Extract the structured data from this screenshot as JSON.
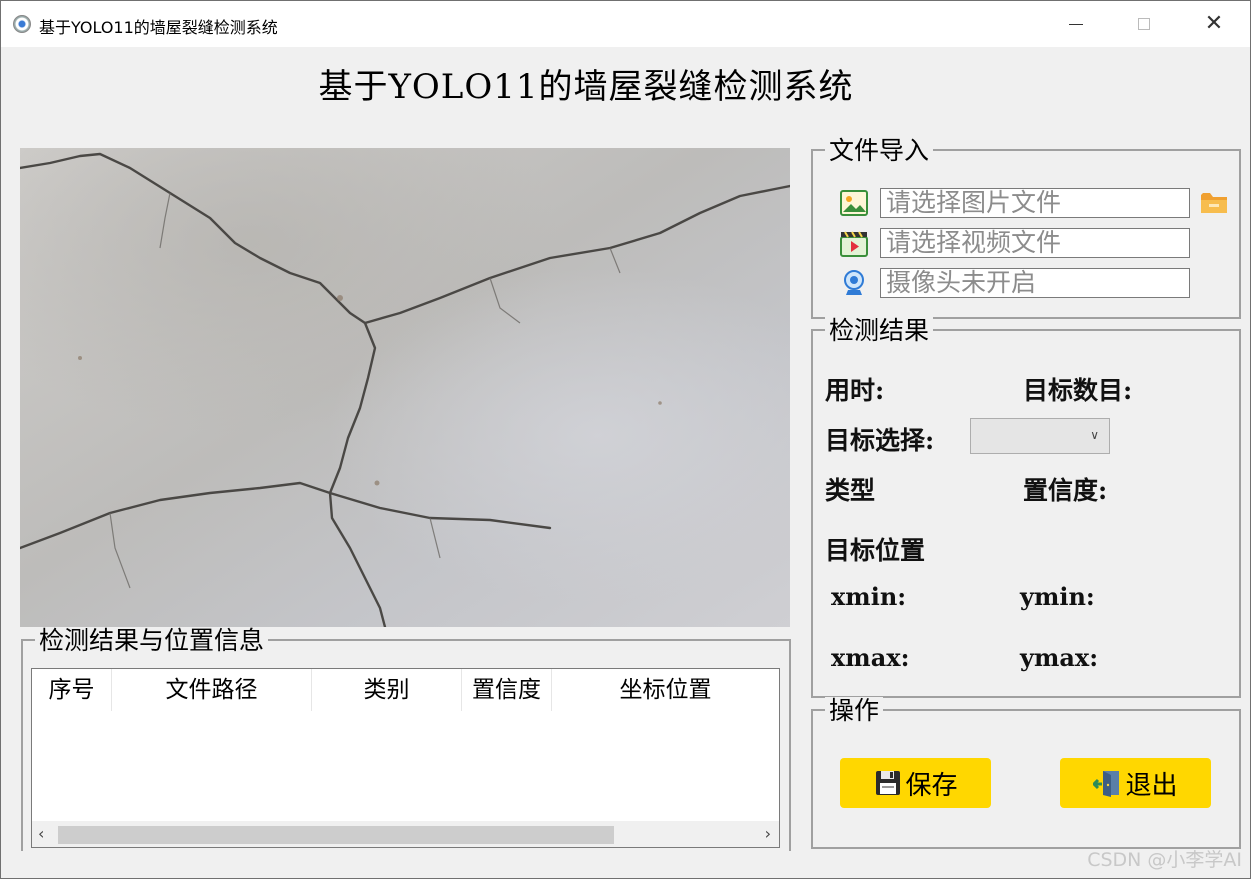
{
  "window": {
    "title": "基于YOLO11的墙屋裂缝检测系统",
    "controls": {
      "minimize": "—",
      "maximize": "□",
      "close": "✕"
    }
  },
  "header": {
    "title": "基于YOLO11的墙屋裂缝检测系统"
  },
  "image_view": {
    "content": "wall-crack-photo"
  },
  "file_import": {
    "group_title": "文件导入",
    "image_placeholder": "请选择图片文件",
    "video_placeholder": "请选择视频文件",
    "camera_placeholder": "摄像头未开启",
    "icons": [
      "image-icon",
      "video-icon",
      "webcam-icon",
      "folder-icon"
    ]
  },
  "detection": {
    "group_title": "检测结果",
    "time_label": "用时:",
    "count_label": "目标数目:",
    "select_label": "目标选择:",
    "select_value": "",
    "type_label": "类型",
    "confidence_label": "置信度:",
    "position_label": "目标位置",
    "xmin_label": "xmin:",
    "ymin_label": "ymin:",
    "xmax_label": "xmax:",
    "ymax_label": "ymax:"
  },
  "operations": {
    "group_title": "操作",
    "save_label": "保存",
    "exit_label": "退出",
    "accent": "#ffd700"
  },
  "results_table": {
    "group_title": "检测结果与位置信息",
    "columns": [
      "序号",
      "文件路径",
      "类别",
      "置信度",
      "坐标位置"
    ],
    "rows": []
  },
  "watermark": "CSDN @小李学AI"
}
